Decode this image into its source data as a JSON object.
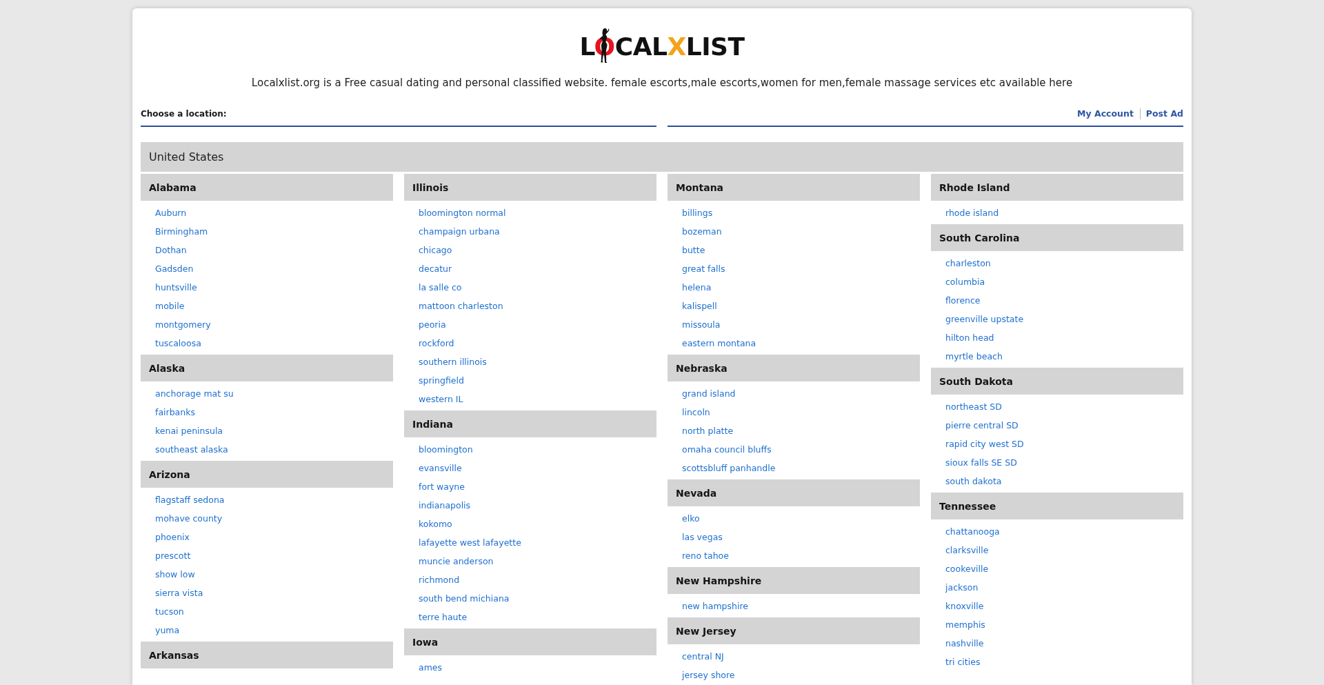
{
  "logo": {
    "parts": [
      {
        "text": "L",
        "color": "#111111"
      },
      {
        "text": "O",
        "color": "#e5141f"
      },
      {
        "text": "CAL",
        "color": "#111111"
      },
      {
        "text": "X",
        "color": "#f4a21c"
      },
      {
        "text": "LIST",
        "color": "#111111"
      }
    ]
  },
  "tagline": "Localxlist.org is a Free casual dating and personal classified website. female escorts,male escorts,women for men,female massage services etc available here",
  "location_bar": {
    "label": "Choose a location:",
    "links": [
      "My Account",
      "Post Ad"
    ]
  },
  "country": "United States",
  "columns": [
    {
      "states": [
        {
          "name": "Alabama",
          "cities": [
            "Auburn",
            "Birmingham",
            "Dothan",
            "Gadsden",
            "huntsville",
            "mobile",
            "montgomery",
            "tuscaloosa"
          ]
        },
        {
          "name": "Alaska",
          "cities": [
            "anchorage mat su",
            "fairbanks",
            "kenai peninsula",
            "southeast alaska"
          ]
        },
        {
          "name": "Arizona",
          "cities": [
            "flagstaff sedona",
            "mohave county",
            "phoenix",
            "prescott",
            "show low",
            "sierra vista",
            "tucson",
            "yuma"
          ]
        },
        {
          "name": "Arkansas"
        }
      ]
    },
    {
      "states": [
        {
          "name": "Illinois",
          "cities": [
            "bloomington normal",
            "champaign urbana",
            "chicago",
            "decatur",
            "la salle co",
            "mattoon charleston",
            "peoria",
            "rockford",
            "southern illinois",
            "springfield",
            "western IL"
          ]
        },
        {
          "name": "Indiana",
          "cities": [
            "bloomington",
            "evansville",
            "fort wayne",
            "indianapolis",
            "kokomo",
            "lafayette west lafayette",
            "muncie anderson",
            "richmond",
            "south bend michiana",
            "terre haute"
          ]
        },
        {
          "name": "Iowa",
          "cities": [
            "ames"
          ]
        }
      ]
    },
    {
      "states": [
        {
          "name": "Montana",
          "cities": [
            "billings",
            "bozeman",
            "butte",
            "great falls",
            "helena",
            "kalispell",
            "missoula",
            "eastern montana"
          ]
        },
        {
          "name": "Nebraska",
          "cities": [
            "grand island",
            "lincoln",
            "north platte",
            "omaha council bluffs",
            "scottsbluff panhandle"
          ]
        },
        {
          "name": "Nevada",
          "cities": [
            "elko",
            "las vegas",
            "reno tahoe"
          ]
        },
        {
          "name": "New Hampshire",
          "cities": [
            "new hampshire"
          ]
        },
        {
          "name": "New Jersey",
          "cities": [
            "central NJ",
            "jersey shore"
          ]
        }
      ]
    },
    {
      "states": [
        {
          "name": "Rhode Island",
          "cities": [
            "rhode island"
          ]
        },
        {
          "name": "South Carolina",
          "cities": [
            "charleston",
            "columbia",
            "florence",
            "greenville upstate",
            "hilton head",
            "myrtle beach"
          ]
        },
        {
          "name": "South Dakota",
          "cities": [
            "northeast SD",
            "pierre central SD",
            "rapid city west SD",
            "sioux falls SE SD",
            "south dakota"
          ]
        },
        {
          "name": "Tennessee",
          "cities": [
            "chattanooga",
            "clarksville",
            "cookeville",
            "jackson",
            "knoxville",
            "memphis",
            "nashville",
            "tri cities"
          ]
        }
      ]
    }
  ]
}
